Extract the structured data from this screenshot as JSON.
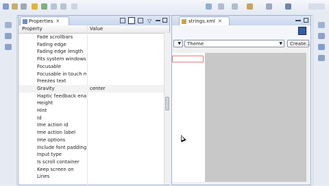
{
  "colors": {
    "accent": "#2f5fa6",
    "view_border": "#9fb0cc",
    "selection_outline": "#e08080"
  },
  "properties_view": {
    "tab_title": "Properties",
    "columns": {
      "property": "Property",
      "value": "Value"
    },
    "rows": [
      {
        "name": "Fade scrollbars",
        "value": ""
      },
      {
        "name": "Fading edge",
        "value": ""
      },
      {
        "name": "Fading edge length",
        "value": ""
      },
      {
        "name": "Fits system windows",
        "value": ""
      },
      {
        "name": "Focusable",
        "value": ""
      },
      {
        "name": "Focusable in touch mode",
        "value": ""
      },
      {
        "name": "Freezes text",
        "value": ""
      },
      {
        "name": "Gravity",
        "value": "center"
      },
      {
        "name": "Haptic feedback enabled",
        "value": ""
      },
      {
        "name": "Height",
        "value": ""
      },
      {
        "name": "Hint",
        "value": ""
      },
      {
        "name": "Id",
        "value": ""
      },
      {
        "name": "Ime action id",
        "value": ""
      },
      {
        "name": "Ime action label",
        "value": ""
      },
      {
        "name": "Ime options",
        "value": ""
      },
      {
        "name": "Include font padding",
        "value": ""
      },
      {
        "name": "Input type",
        "value": ""
      },
      {
        "name": "Is scroll container",
        "value": ""
      },
      {
        "name": "Keep screen on",
        "value": ""
      },
      {
        "name": "Lines",
        "value": ""
      }
    ]
  },
  "editor": {
    "tab_title": "strings.xml",
    "theme_label": "Theme",
    "create_label": "Create..."
  },
  "icons": [
    "collapse-icon",
    "tree-icon",
    "filter-icon",
    "close-icon",
    "layout-icon",
    "dropdown-arrow-icon"
  ]
}
